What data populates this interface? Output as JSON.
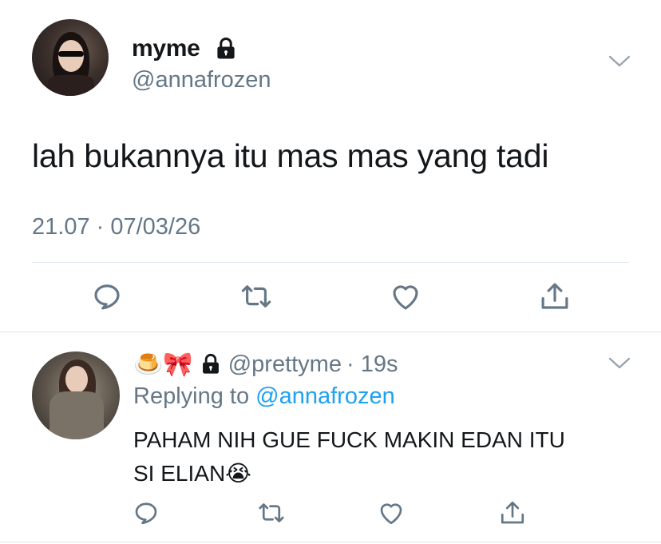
{
  "tweet": {
    "display_name": "myme",
    "handle": "@annafrozen",
    "text": "lah bukannya itu mas mas yang tadi",
    "meta": "21.07 · 07/03/26",
    "icons": [
      "lock-icon",
      "chevron-down-icon",
      "reply-icon",
      "retweet-icon",
      "like-icon",
      "share-icon"
    ]
  },
  "reply": {
    "name_emojis": "🍮🎀",
    "handle": "@prettyme",
    "time": "· 19s",
    "replying_prefix": "Replying to",
    "replying_to": "@annafrozen",
    "text_line1": "PAHAM NIH GUE FUCK MAKIN EDAN ITU",
    "text_line2": "SI ELIAN",
    "text_emoji": "😭"
  },
  "colors": {
    "text": "#14171a",
    "secondary": "#657786",
    "link": "#1da1f2",
    "divider": "#e1e8ed"
  }
}
